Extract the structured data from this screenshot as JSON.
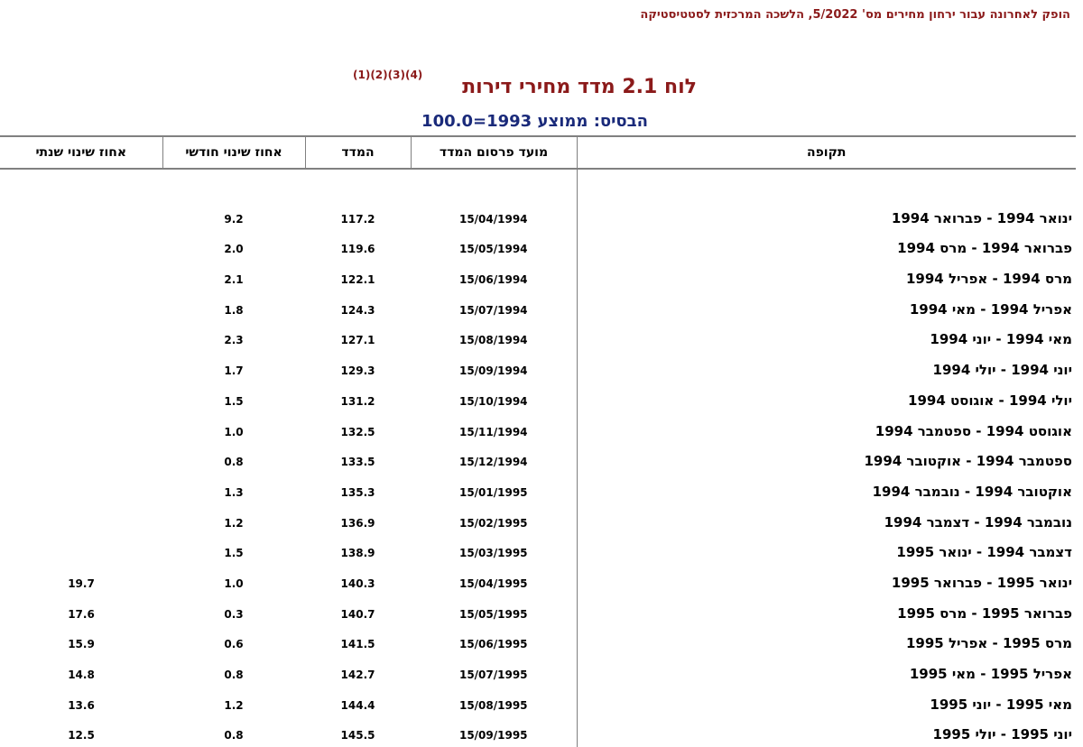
{
  "header_note": "הופק לאחרונה עבור ירחון מחירים מס' 5/2022, הלשכה המרכזית לסטטיסטיקה",
  "title": "לוח 2.1 מדד מחירי דירות",
  "notes_ref": "(1)(2)(3)(4)",
  "base": "הבסיס: ממוצע 1993=100.0",
  "columns": {
    "period": "תקופה",
    "publish_date": "מועד פרסום המדד",
    "index": "המדד",
    "monthly_change": "אחוז שינוי חודשי",
    "annual_change": "אחוז שינוי שנתי"
  },
  "rows": [
    {
      "period": "ינואר 1994 - פברואר 1994",
      "date": "15/04/1994",
      "index": "117.2",
      "monthly": "9.2",
      "annual": ""
    },
    {
      "period": "פברואר 1994 - מרס 1994",
      "date": "15/05/1994",
      "index": "119.6",
      "monthly": "2.0",
      "annual": ""
    },
    {
      "period": "מרס 1994 - אפריל 1994",
      "date": "15/06/1994",
      "index": "122.1",
      "monthly": "2.1",
      "annual": ""
    },
    {
      "period": "אפריל 1994 - מאי 1994",
      "date": "15/07/1994",
      "index": "124.3",
      "monthly": "1.8",
      "annual": ""
    },
    {
      "period": "מאי 1994 - יוני 1994",
      "date": "15/08/1994",
      "index": "127.1",
      "monthly": "2.3",
      "annual": ""
    },
    {
      "period": "יוני 1994 - יולי 1994",
      "date": "15/09/1994",
      "index": "129.3",
      "monthly": "1.7",
      "annual": ""
    },
    {
      "period": "יולי 1994 - אוגוסט 1994",
      "date": "15/10/1994",
      "index": "131.2",
      "monthly": "1.5",
      "annual": ""
    },
    {
      "period": "אוגוסט 1994 - ספטמבר 1994",
      "date": "15/11/1994",
      "index": "132.5",
      "monthly": "1.0",
      "annual": ""
    },
    {
      "period": "ספטמבר 1994 - אוקטובר 1994",
      "date": "15/12/1994",
      "index": "133.5",
      "monthly": "0.8",
      "annual": ""
    },
    {
      "period": "אוקטובר 1994 - נובמבר 1994",
      "date": "15/01/1995",
      "index": "135.3",
      "monthly": "1.3",
      "annual": ""
    },
    {
      "period": "נובמבר 1994 - דצמבר 1994",
      "date": "15/02/1995",
      "index": "136.9",
      "monthly": "1.2",
      "annual": ""
    },
    {
      "period": "דצמבר 1994 - ינואר 1995",
      "date": "15/03/1995",
      "index": "138.9",
      "monthly": "1.5",
      "annual": ""
    },
    {
      "period": "ינואר 1995 - פברואר 1995",
      "date": "15/04/1995",
      "index": "140.3",
      "monthly": "1.0",
      "annual": "19.7"
    },
    {
      "period": "פברואר 1995 - מרס 1995",
      "date": "15/05/1995",
      "index": "140.7",
      "monthly": "0.3",
      "annual": "17.6"
    },
    {
      "period": "מרס 1995 - אפריל 1995",
      "date": "15/06/1995",
      "index": "141.5",
      "monthly": "0.6",
      "annual": "15.9"
    },
    {
      "period": "אפריל 1995 - מאי 1995",
      "date": "15/07/1995",
      "index": "142.7",
      "monthly": "0.8",
      "annual": "14.8"
    },
    {
      "period": "מאי 1995 - יוני 1995",
      "date": "15/08/1995",
      "index": "144.4",
      "monthly": "1.2",
      "annual": "13.6"
    },
    {
      "period": "יוני 1995 - יולי 1995",
      "date": "15/09/1995",
      "index": "145.5",
      "monthly": "0.8",
      "annual": "12.5"
    }
  ]
}
